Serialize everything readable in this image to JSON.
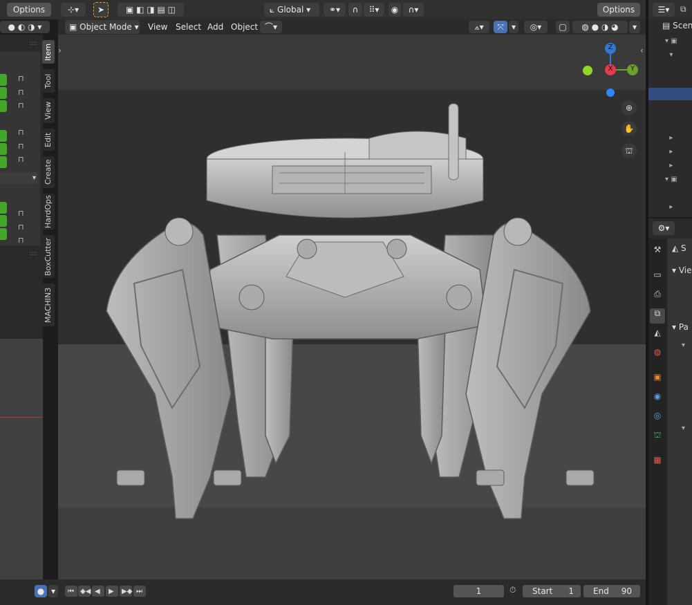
{
  "top_header": {
    "options_left": "Options",
    "orientation": "Global",
    "options_right": "Options"
  },
  "viewport_header": {
    "mode": "Object Mode",
    "menus": [
      "View",
      "Select",
      "Add",
      "Object"
    ]
  },
  "sidebar_tabs": [
    "Item",
    "Tool",
    "View",
    "Edit",
    "Create",
    "HardOps",
    "BoxCutter",
    "MACHIN3"
  ],
  "gizmo": {
    "axis_z": "Z",
    "axis_x": "X",
    "axis_y": "Y"
  },
  "outliner": {
    "scene_label": "Scen"
  },
  "properties": {
    "row1": "S",
    "section_view": "Vie",
    "section_pa": "Pa"
  },
  "timeline": {
    "current_frame": "1",
    "start_label": "Start",
    "start_value": "1",
    "end_label": "End",
    "end_value": "90"
  },
  "colors": {
    "accent_blue": "#4772b3",
    "green_field": "#45a62c",
    "axis_x": "#e83a4f",
    "axis_y": "#6ba32e",
    "axis_z": "#2f78d6"
  }
}
